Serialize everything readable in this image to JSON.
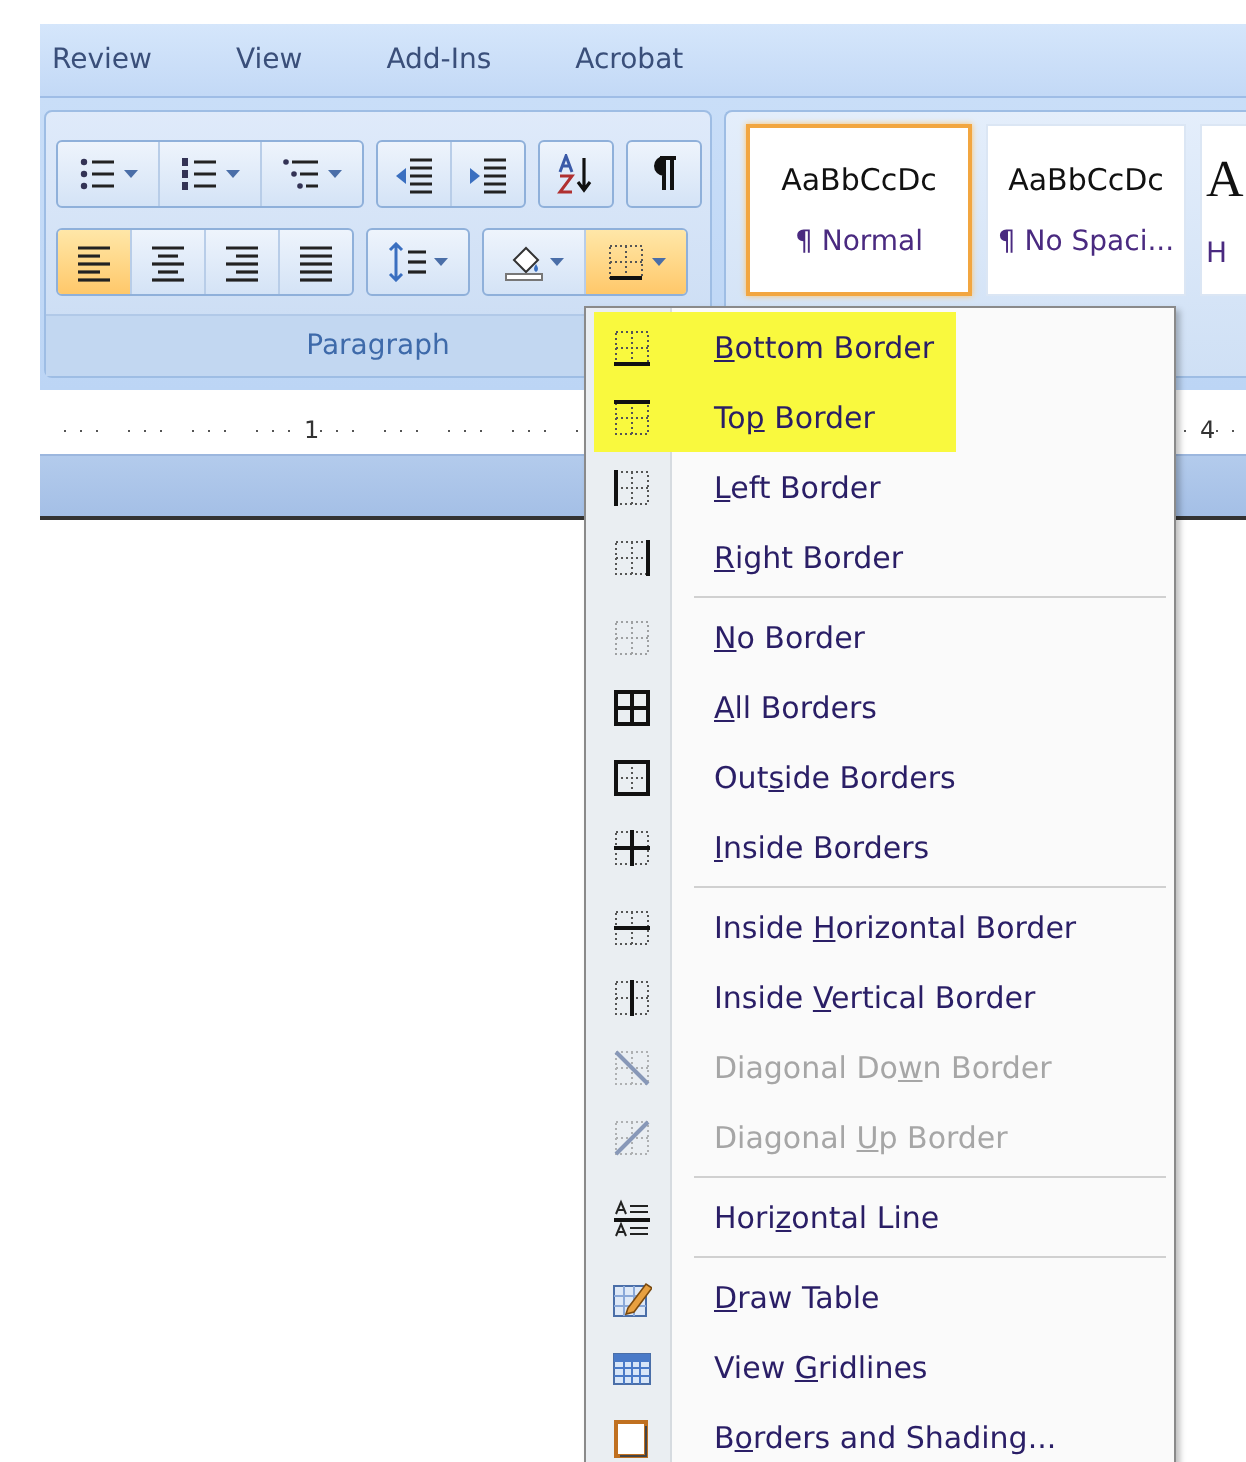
{
  "tabs": [
    {
      "label": "Review"
    },
    {
      "label": "View"
    },
    {
      "label": "Add-Ins"
    },
    {
      "label": "Acrobat"
    }
  ],
  "paragraph_group": {
    "label": "Paragraph",
    "rows": [
      [
        [
          {
            "kind": "bullets",
            "dropdown": true,
            "selected": false
          },
          {
            "kind": "numbering",
            "dropdown": true,
            "selected": false
          },
          {
            "kind": "multilevel",
            "dropdown": true,
            "selected": false
          }
        ],
        [
          {
            "kind": "outdent",
            "dropdown": false,
            "selected": false
          },
          {
            "kind": "indent",
            "dropdown": false,
            "selected": false
          }
        ],
        [
          {
            "kind": "sort",
            "dropdown": false,
            "selected": false
          }
        ],
        [
          {
            "kind": "pilcrow",
            "dropdown": false,
            "selected": false
          }
        ]
      ],
      [
        [
          {
            "kind": "align-left",
            "dropdown": false,
            "selected": true
          },
          {
            "kind": "align-center",
            "dropdown": false,
            "selected": false
          },
          {
            "kind": "align-right",
            "dropdown": false,
            "selected": false
          },
          {
            "kind": "justify",
            "dropdown": false,
            "selected": false
          }
        ],
        [
          {
            "kind": "line-spacing",
            "dropdown": true,
            "selected": false
          }
        ],
        [
          {
            "kind": "shading",
            "dropdown": true,
            "selected": false
          },
          {
            "kind": "borders",
            "dropdown": true,
            "selected": true
          }
        ]
      ]
    ]
  },
  "styles": [
    {
      "preview": "AaBbCcDc",
      "name": "¶ Normal",
      "selected": true
    },
    {
      "preview": "AaBbCcDc",
      "name": "¶ No Spaci...",
      "selected": false
    },
    {
      "preview": "A",
      "name": "H",
      "selected": false
    }
  ],
  "ruler": {
    "labels": [
      "1",
      "4"
    ]
  },
  "border_menu": {
    "sections": [
      [
        {
          "kind": "bottom",
          "key": "B",
          "after": "ottom Border",
          "highlighted": true,
          "disabled": false
        },
        {
          "kind": "top",
          "before": "To",
          "key": "p",
          "after": " Border",
          "highlighted": true,
          "disabled": false
        },
        {
          "kind": "left",
          "key": "L",
          "after": "eft Border",
          "highlighted": false,
          "disabled": false
        },
        {
          "kind": "right",
          "key": "R",
          "after": "ight Border",
          "highlighted": false,
          "disabled": false
        }
      ],
      [
        {
          "kind": "none",
          "key": "N",
          "after": "o Border",
          "highlighted": false,
          "disabled": false
        },
        {
          "kind": "all",
          "key": "A",
          "after": "ll Borders",
          "highlighted": false,
          "disabled": false
        },
        {
          "kind": "outside",
          "before": "Out",
          "key": "s",
          "after": "ide Borders",
          "highlighted": false,
          "disabled": false
        },
        {
          "kind": "inside",
          "key": "I",
          "after": "nside Borders",
          "highlighted": false,
          "disabled": false
        }
      ],
      [
        {
          "kind": "inside-h",
          "before": "Inside ",
          "key": "H",
          "after": "orizontal Border",
          "highlighted": false,
          "disabled": false
        },
        {
          "kind": "inside-v",
          "before": "Inside ",
          "key": "V",
          "after": "ertical Border",
          "highlighted": false,
          "disabled": false
        },
        {
          "kind": "diag-down",
          "before": "Diagonal Do",
          "key": "w",
          "after": "n Border",
          "highlighted": false,
          "disabled": true
        },
        {
          "kind": "diag-up",
          "before": "Diagonal ",
          "key": "U",
          "after": "p Border",
          "highlighted": false,
          "disabled": true
        }
      ],
      [
        {
          "kind": "hline",
          "before": "Hori",
          "key": "z",
          "after": "ontal Line",
          "highlighted": false,
          "disabled": false
        }
      ],
      [
        {
          "kind": "draw-table",
          "key": "D",
          "after": "raw Table",
          "highlighted": false,
          "disabled": false
        },
        {
          "kind": "gridlines",
          "before": "View ",
          "key": "G",
          "after": "ridlines",
          "highlighted": false,
          "disabled": false
        },
        {
          "kind": "shading-dialog",
          "before": "B",
          "key": "o",
          "after": "rders and Shading...",
          "highlighted": false,
          "disabled": false
        }
      ]
    ]
  }
}
